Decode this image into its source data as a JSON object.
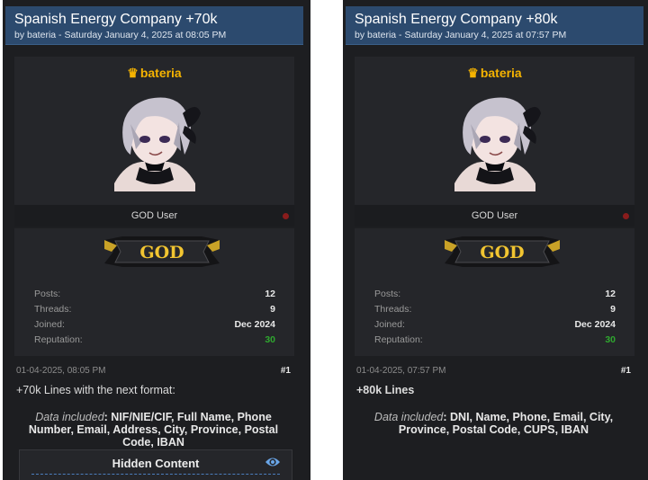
{
  "colors": {
    "header_bg": "#2c4a6e",
    "username": "#f5b301",
    "reputation": "#2fa82f",
    "panel_bg": "#1d1e21"
  },
  "left": {
    "title": "Spanish Energy Company +70k",
    "byline": "by bateria - Saturday January 4, 2025 at 08:05 PM",
    "username": "bateria",
    "rank": "GOD User",
    "badge_text": "GOD",
    "stats": {
      "posts_label": "Posts:",
      "posts": "12",
      "threads_label": "Threads:",
      "threads": "9",
      "joined_label": "Joined:",
      "joined": "Dec 2024",
      "reputation_label": "Reputation:",
      "reputation": "30"
    },
    "post_date": "01-04-2025, 08:05 PM",
    "post_number": "#1",
    "heading": "+70k Lines with the next format:",
    "data_label": "Data included",
    "data_text": ": NIF/NIE/CIF, Full Name, Phone Number, Email, Address, City, Province, Postal Code, IBAN",
    "hidden_title": "Hidden Content"
  },
  "right": {
    "title": "Spanish Energy Company +80k",
    "byline": "by bateria - Saturday January 4, 2025 at 07:57 PM",
    "username": "bateria",
    "rank": "GOD User",
    "badge_text": "GOD",
    "stats": {
      "posts_label": "Posts:",
      "posts": "12",
      "threads_label": "Threads:",
      "threads": "9",
      "joined_label": "Joined:",
      "joined": "Dec 2024",
      "reputation_label": "Reputation:",
      "reputation": "30"
    },
    "post_date": "01-04-2025, 07:57 PM",
    "post_number": "#1",
    "heading": "+80k Lines",
    "data_label": "Data included",
    "data_text": ": DNI, Name, Phone, Email, City, Province, Postal Code, CUPS, IBAN"
  }
}
